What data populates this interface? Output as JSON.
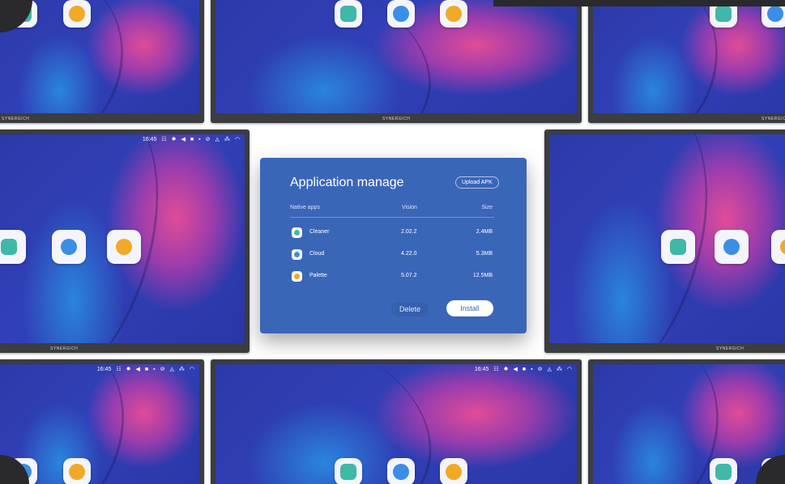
{
  "brand": "SYNERGICH",
  "status": {
    "time": "16:45",
    "icons": [
      "sliders-icon",
      "brightness-icon",
      "volume-icon",
      "camera-icon",
      "record-icon",
      "screenshot-icon",
      "network-icon",
      "share-icon",
      "wifi-icon"
    ]
  },
  "apps": [
    {
      "name": "Cleaner",
      "icon": "cleaner-icon",
      "color": "#3fb8a8"
    },
    {
      "name": "Cloud",
      "icon": "cloud-upload-icon",
      "color": "#3b8ee6"
    },
    {
      "name": "Palette",
      "icon": "palette-icon",
      "color": "#f1a928"
    }
  ],
  "dialog": {
    "title": "Application manage",
    "upload_label": "Upload APK",
    "columns": {
      "name": "Native apps",
      "version": "Vision",
      "size": "Size"
    },
    "rows": [
      {
        "name": "Cleaner",
        "version": "2.02.2",
        "size": "2.4MB",
        "color": "#3fb8a8"
      },
      {
        "name": "Cloud",
        "version": "4.22.0",
        "size": "5.3MB",
        "color": "#3b8ee6"
      },
      {
        "name": "Palette",
        "version": "5.07.2",
        "size": "12.5MB",
        "color": "#f1a928"
      }
    ],
    "delete_label": "Delete",
    "install_label": "Install"
  }
}
